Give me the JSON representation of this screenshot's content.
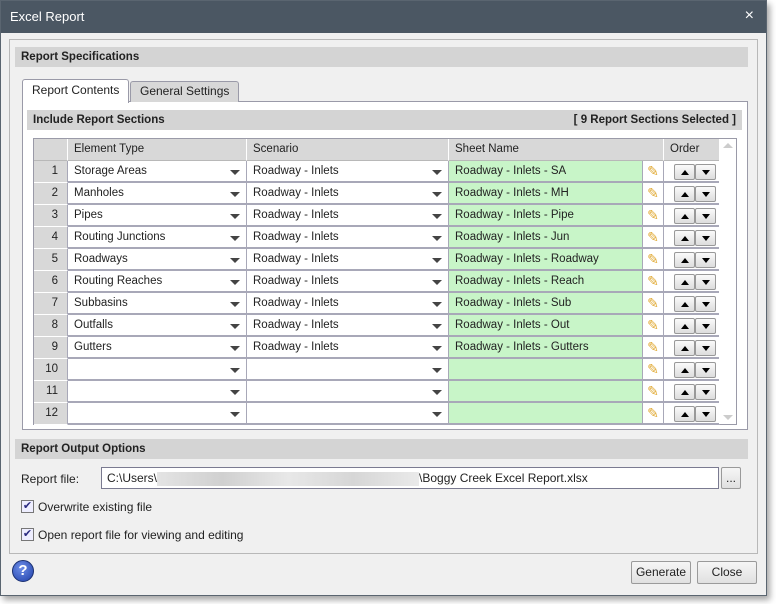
{
  "window": {
    "title": "Excel Report",
    "close_icon": "×"
  },
  "spec_header": "Report Specifications",
  "tabs": [
    {
      "label": "Report Contents",
      "active": true
    },
    {
      "label": "General Settings",
      "active": false
    }
  ],
  "sections_header": "Include Report Sections",
  "sections_count": "[ 9 Report Sections Selected ]",
  "columns": {
    "element_type": "Element Type",
    "scenario": "Scenario",
    "sheet_name": "Sheet Name",
    "order": "Order"
  },
  "rows": [
    {
      "n": "1",
      "element": "Storage Areas",
      "scenario": "Roadway - Inlets",
      "sheet": "Roadway - Inlets - SA"
    },
    {
      "n": "2",
      "element": "Manholes",
      "scenario": "Roadway - Inlets",
      "sheet": "Roadway - Inlets - MH"
    },
    {
      "n": "3",
      "element": "Pipes",
      "scenario": "Roadway - Inlets",
      "sheet": "Roadway - Inlets - Pipe"
    },
    {
      "n": "4",
      "element": "Routing Junctions",
      "scenario": "Roadway - Inlets",
      "sheet": "Roadway - Inlets - Jun"
    },
    {
      "n": "5",
      "element": "Roadways",
      "scenario": "Roadway - Inlets",
      "sheet": "Roadway - Inlets - Roadway"
    },
    {
      "n": "6",
      "element": "Routing Reaches",
      "scenario": "Roadway - Inlets",
      "sheet": "Roadway - Inlets - Reach"
    },
    {
      "n": "7",
      "element": "Subbasins",
      "scenario": "Roadway - Inlets",
      "sheet": "Roadway - Inlets - Sub"
    },
    {
      "n": "8",
      "element": "Outfalls",
      "scenario": "Roadway - Inlets",
      "sheet": "Roadway - Inlets - Out"
    },
    {
      "n": "9",
      "element": "Gutters",
      "scenario": "Roadway - Inlets",
      "sheet": "Roadway - Inlets - Gutters"
    },
    {
      "n": "10",
      "element": "",
      "scenario": "",
      "sheet": ""
    },
    {
      "n": "11",
      "element": "",
      "scenario": "",
      "sheet": ""
    },
    {
      "n": "12",
      "element": "",
      "scenario": "",
      "sheet": ""
    }
  ],
  "output_header": "Report Output Options",
  "report_file": {
    "label": "Report file:",
    "prefix": "C:\\Users\\",
    "suffix": "\\Boggy Creek Excel Report.xlsx",
    "browse": "..."
  },
  "options": [
    {
      "label": "Overwrite existing file",
      "checked": true
    },
    {
      "label": "Open report file for viewing and editing",
      "checked": true
    }
  ],
  "buttons": {
    "help": "?",
    "generate": "Generate",
    "close": "Close"
  }
}
